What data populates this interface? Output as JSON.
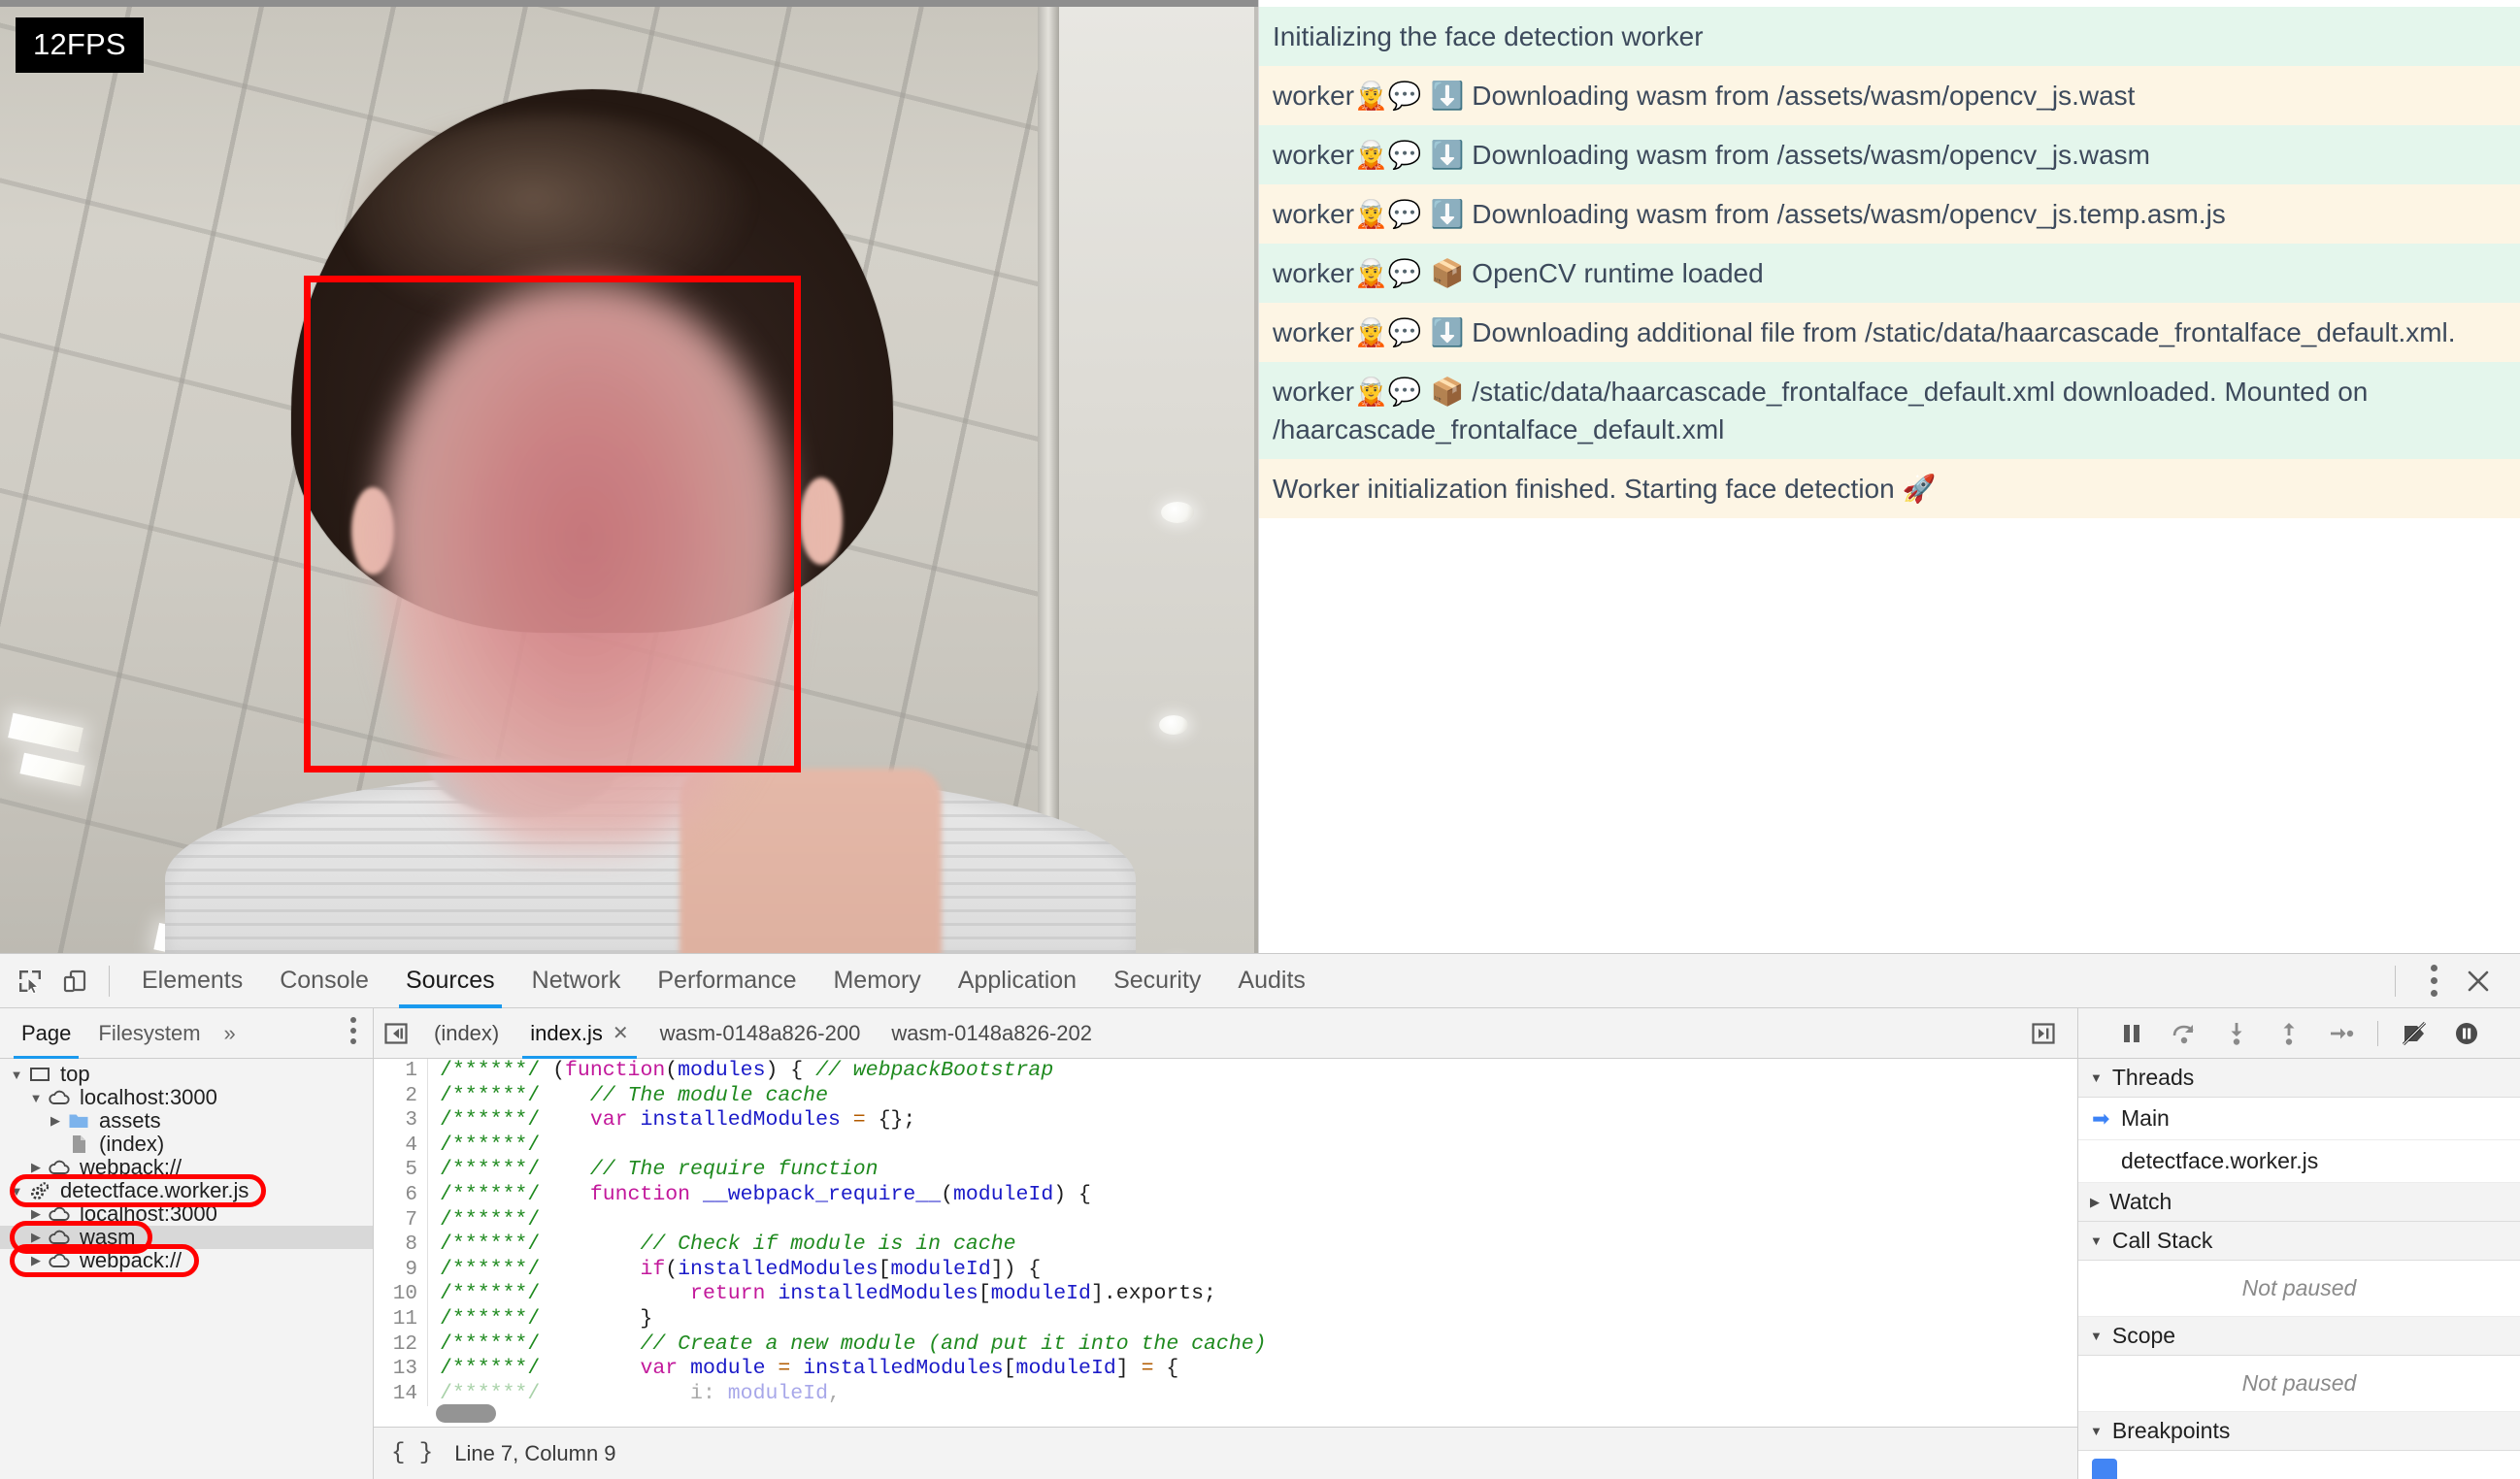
{
  "viewport": {
    "fps_badge": "12FPS"
  },
  "log": {
    "rows": [
      {
        "tone": "green",
        "prefix": "",
        "emojis": "",
        "text": "Initializing the face detection worker"
      },
      {
        "tone": "cream",
        "prefix": "worker",
        "emojis": "🧝💬 ⬇️",
        "text": "Downloading wasm from /assets/wasm/opencv_js.wast"
      },
      {
        "tone": "green",
        "prefix": "worker",
        "emojis": "🧝💬 ⬇️",
        "text": "Downloading wasm from /assets/wasm/opencv_js.wasm"
      },
      {
        "tone": "cream",
        "prefix": "worker",
        "emojis": "🧝💬 ⬇️",
        "text": "Downloading wasm from /assets/wasm/opencv_js.temp.asm.js"
      },
      {
        "tone": "green",
        "prefix": "worker",
        "emojis": "🧝💬 📦",
        "text": "OpenCV runtime loaded"
      },
      {
        "tone": "cream",
        "prefix": "worker",
        "emojis": "🧝💬 ⬇️",
        "text": " Downloading additional file from /static/data/haarcascade_frontalface_default.xml."
      },
      {
        "tone": "green",
        "prefix": "worker",
        "emojis": "🧝💬 📦",
        "text": "/static/data/haarcascade_frontalface_default.xml downloaded. Mounted on /haarcascade_frontalface_default.xml"
      },
      {
        "tone": "cream",
        "prefix": "",
        "emojis": "",
        "text": "Worker initialization finished. Starting face detection 🚀"
      }
    ]
  },
  "devtools": {
    "toolbar": {
      "inspect_icon": "inspect-element-icon",
      "device_icon": "device-toolbar-icon",
      "panels": [
        {
          "label": "Elements",
          "active": false
        },
        {
          "label": "Console",
          "active": false
        },
        {
          "label": "Sources",
          "active": true
        },
        {
          "label": "Network",
          "active": false
        },
        {
          "label": "Performance",
          "active": false
        },
        {
          "label": "Memory",
          "active": false
        },
        {
          "label": "Application",
          "active": false
        },
        {
          "label": "Security",
          "active": false
        },
        {
          "label": "Audits",
          "active": false
        }
      ],
      "more_icon": "kebab-menu-icon",
      "close_icon": "close-icon"
    },
    "navigator": {
      "tabs": [
        {
          "label": "Page",
          "active": true
        },
        {
          "label": "Filesystem",
          "active": false
        }
      ],
      "overflow_label": "»",
      "more_icon": "kebab-menu-icon",
      "tree": [
        {
          "label": "top",
          "indent": 0,
          "twisty": "open",
          "icon": "frame-icon",
          "selected": false,
          "annotated": false
        },
        {
          "label": "localhost:3000",
          "indent": 1,
          "twisty": "open",
          "icon": "cloud-icon",
          "selected": false,
          "annotated": false
        },
        {
          "label": "assets",
          "indent": 2,
          "twisty": "closed",
          "icon": "folder-icon",
          "selected": false,
          "annotated": false
        },
        {
          "label": "(index)",
          "indent": 2,
          "twisty": "none",
          "icon": "document-icon",
          "selected": false,
          "annotated": false
        },
        {
          "label": "webpack://",
          "indent": 1,
          "twisty": "closed",
          "icon": "cloud-icon",
          "selected": false,
          "annotated": false
        },
        {
          "label": "detectface.worker.js",
          "indent": 0,
          "twisty": "open",
          "icon": "worker-icon",
          "selected": false,
          "annotated": true
        },
        {
          "label": "localhost:3000",
          "indent": 1,
          "twisty": "closed",
          "icon": "cloud-icon",
          "selected": false,
          "annotated": false
        },
        {
          "label": "wasm",
          "indent": 1,
          "twisty": "closed",
          "icon": "cloud-icon",
          "selected": true,
          "annotated": true
        },
        {
          "label": "webpack://",
          "indent": 1,
          "twisty": "closed",
          "icon": "cloud-icon",
          "selected": false,
          "annotated": true
        }
      ]
    },
    "editor": {
      "nav_back_icon": "show-navigator-icon",
      "tabs": [
        {
          "label": "(index)",
          "active": false,
          "closable": false
        },
        {
          "label": "index.js",
          "active": true,
          "closable": true
        },
        {
          "label": "wasm-0148a826-200",
          "active": false,
          "closable": false
        },
        {
          "label": "wasm-0148a826-202",
          "active": false,
          "closable": false
        }
      ],
      "show_debugger_icon": "show-debugger-icon",
      "lines": [
        {
          "n": "1",
          "faded": false,
          "segments": [
            {
              "c": "c-star",
              "t": "/******/"
            },
            {
              "c": "c-pl",
              "t": " ("
            },
            {
              "c": "c-kw",
              "t": "function"
            },
            {
              "c": "c-pl",
              "t": "("
            },
            {
              "c": "c-var",
              "t": "modules"
            },
            {
              "c": "c-pl",
              "t": ") { "
            },
            {
              "c": "c-cmt",
              "t": "// webpackBootstrap"
            }
          ]
        },
        {
          "n": "2",
          "faded": false,
          "segments": [
            {
              "c": "c-star",
              "t": "/******/"
            },
            {
              "c": "c-pl",
              "t": "    "
            },
            {
              "c": "c-cmt",
              "t": "// The module cache"
            }
          ]
        },
        {
          "n": "3",
          "faded": false,
          "segments": [
            {
              "c": "c-star",
              "t": "/******/"
            },
            {
              "c": "c-pl",
              "t": "    "
            },
            {
              "c": "c-kw",
              "t": "var"
            },
            {
              "c": "c-pl",
              "t": " "
            },
            {
              "c": "c-var",
              "t": "installedModules"
            },
            {
              "c": "c-pl",
              "t": " "
            },
            {
              "c": "c-op",
              "t": "="
            },
            {
              "c": "c-pl",
              "t": " {};"
            }
          ]
        },
        {
          "n": "4",
          "faded": false,
          "segments": [
            {
              "c": "c-star",
              "t": "/******/"
            }
          ]
        },
        {
          "n": "5",
          "faded": false,
          "segments": [
            {
              "c": "c-star",
              "t": "/******/"
            },
            {
              "c": "c-pl",
              "t": "    "
            },
            {
              "c": "c-cmt",
              "t": "// The require function"
            }
          ]
        },
        {
          "n": "6",
          "faded": false,
          "segments": [
            {
              "c": "c-star",
              "t": "/******/"
            },
            {
              "c": "c-pl",
              "t": "    "
            },
            {
              "c": "c-kw",
              "t": "function"
            },
            {
              "c": "c-pl",
              "t": " "
            },
            {
              "c": "c-var",
              "t": "__webpack_require__"
            },
            {
              "c": "c-pl",
              "t": "("
            },
            {
              "c": "c-var",
              "t": "moduleId"
            },
            {
              "c": "c-pl",
              "t": ") {"
            }
          ]
        },
        {
          "n": "7",
          "faded": false,
          "segments": [
            {
              "c": "c-star",
              "t": "/******/"
            }
          ]
        },
        {
          "n": "8",
          "faded": false,
          "segments": [
            {
              "c": "c-star",
              "t": "/******/"
            },
            {
              "c": "c-pl",
              "t": "        "
            },
            {
              "c": "c-cmt",
              "t": "// Check if module is in cache"
            }
          ]
        },
        {
          "n": "9",
          "faded": false,
          "segments": [
            {
              "c": "c-star",
              "t": "/******/"
            },
            {
              "c": "c-pl",
              "t": "        "
            },
            {
              "c": "c-kw",
              "t": "if"
            },
            {
              "c": "c-pl",
              "t": "("
            },
            {
              "c": "c-var",
              "t": "installedModules"
            },
            {
              "c": "c-pl",
              "t": "["
            },
            {
              "c": "c-var",
              "t": "moduleId"
            },
            {
              "c": "c-pl",
              "t": "]) {"
            }
          ]
        },
        {
          "n": "10",
          "faded": false,
          "segments": [
            {
              "c": "c-star",
              "t": "/******/"
            },
            {
              "c": "c-pl",
              "t": "            "
            },
            {
              "c": "c-kw",
              "t": "return"
            },
            {
              "c": "c-pl",
              "t": " "
            },
            {
              "c": "c-var",
              "t": "installedModules"
            },
            {
              "c": "c-pl",
              "t": "["
            },
            {
              "c": "c-var",
              "t": "moduleId"
            },
            {
              "c": "c-pl",
              "t": "].exports;"
            }
          ]
        },
        {
          "n": "11",
          "faded": false,
          "segments": [
            {
              "c": "c-star",
              "t": "/******/"
            },
            {
              "c": "c-pl",
              "t": "        }"
            }
          ]
        },
        {
          "n": "12",
          "faded": false,
          "segments": [
            {
              "c": "c-star",
              "t": "/******/"
            },
            {
              "c": "c-pl",
              "t": "        "
            },
            {
              "c": "c-cmt",
              "t": "// Create a new module (and put it into the cache)"
            }
          ]
        },
        {
          "n": "13",
          "faded": false,
          "segments": [
            {
              "c": "c-star",
              "t": "/******/"
            },
            {
              "c": "c-pl",
              "t": "        "
            },
            {
              "c": "c-kw",
              "t": "var"
            },
            {
              "c": "c-pl",
              "t": " "
            },
            {
              "c": "c-var",
              "t": "module"
            },
            {
              "c": "c-pl",
              "t": " "
            },
            {
              "c": "c-op",
              "t": "="
            },
            {
              "c": "c-pl",
              "t": " "
            },
            {
              "c": "c-var",
              "t": "installedModules"
            },
            {
              "c": "c-pl",
              "t": "["
            },
            {
              "c": "c-var",
              "t": "moduleId"
            },
            {
              "c": "c-pl",
              "t": "] "
            },
            {
              "c": "c-op",
              "t": "="
            },
            {
              "c": "c-pl",
              "t": " {"
            }
          ]
        },
        {
          "n": "14",
          "faded": true,
          "segments": [
            {
              "c": "c-star",
              "t": "/******/"
            },
            {
              "c": "c-pl",
              "t": "            i: "
            },
            {
              "c": "c-var",
              "t": "moduleId"
            },
            {
              "c": "c-pl",
              "t": ","
            }
          ]
        }
      ],
      "status": {
        "format_icon": "pretty-print-icon",
        "cursor": "Line 7, Column 9"
      }
    },
    "debugger": {
      "controls": [
        {
          "icon": "pause-icon",
          "name": "pause-script-button"
        },
        {
          "icon": "step-over-icon",
          "name": "step-over-button"
        },
        {
          "icon": "step-into-icon",
          "name": "step-into-button"
        },
        {
          "icon": "step-out-icon",
          "name": "step-out-button"
        },
        {
          "icon": "step-icon",
          "name": "step-button"
        },
        {
          "icon": "deactivate-breakpoints-icon",
          "name": "deactivate-breakpoints-button"
        },
        {
          "icon": "pause-on-exceptions-icon",
          "name": "pause-on-exceptions-button"
        }
      ],
      "sections": [
        {
          "title": "Threads",
          "expanded": true,
          "items": [
            {
              "label": "Main",
              "current": true
            },
            {
              "label": "detectface.worker.js",
              "current": false
            }
          ],
          "empty": null
        },
        {
          "title": "Watch",
          "expanded": false,
          "items": [],
          "empty": null
        },
        {
          "title": "Call Stack",
          "expanded": true,
          "items": [],
          "empty": "Not paused"
        },
        {
          "title": "Scope",
          "expanded": true,
          "items": [],
          "empty": "Not paused"
        },
        {
          "title": "Breakpoints",
          "expanded": true,
          "items": [],
          "empty": null
        }
      ]
    }
  },
  "colors": {
    "accent": "#1a9aee",
    "annotation": "#ff0000",
    "detection_box": "#ff0000",
    "log_green": "#e4f6ec",
    "log_cream": "#fdf5e4",
    "thread_current": "#3b82f6",
    "breakpoint_checkbox": "#4285f4"
  }
}
